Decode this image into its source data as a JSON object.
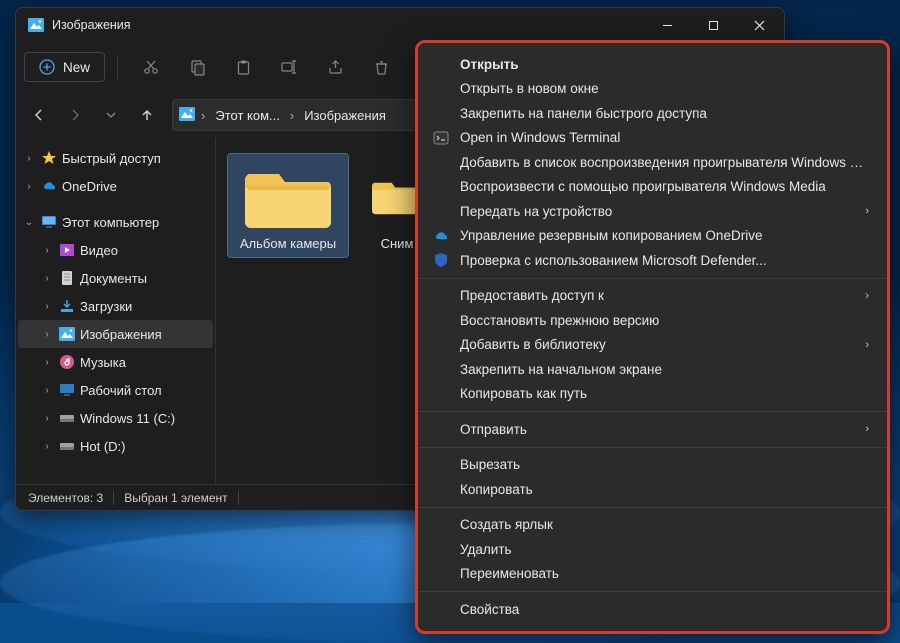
{
  "window": {
    "title": "Изображения"
  },
  "toolbar": {
    "new_label": "New"
  },
  "breadcrumb": {
    "seg1": "Этот ком...",
    "seg2": "Изображения"
  },
  "sidebar": {
    "quick_access": "Быстрый доступ",
    "onedrive": "OneDrive",
    "this_pc": "Этот компьютер",
    "videos": "Видео",
    "documents": "Документы",
    "downloads": "Загрузки",
    "pictures": "Изображения",
    "music": "Музыка",
    "desktop": "Рабочий стол",
    "cdrive": "Windows 11 (C:)",
    "ddrive": "Hot (D:)"
  },
  "content": {
    "folder1": "Альбом камеры",
    "folder2": "Сним"
  },
  "statusbar": {
    "count": "Элементов: 3",
    "selection": "Выбран 1 элемент"
  },
  "contextmenu": {
    "g1": {
      "open": "Открыть",
      "open_new_window": "Открыть в новом окне",
      "pin_quick_access": "Закрепить на панели быстрого доступа",
      "open_terminal": "Open in Windows Terminal",
      "add_wmp_playlist": "Добавить в список воспроизведения проигрывателя Windows Media",
      "play_wmp": "Воспроизвести с помощью проигрывателя Windows Media",
      "cast": "Передать на устройство",
      "onedrive_backup": "Управление резервным копированием OneDrive",
      "defender": "Проверка с использованием Microsoft Defender..."
    },
    "g2": {
      "give_access": "Предоставить доступ к",
      "restore_version": "Восстановить прежнюю версию",
      "add_library": "Добавить в библиотеку",
      "pin_start": "Закрепить на начальном экране",
      "copy_as_path": "Копировать как путь"
    },
    "g3": {
      "send_to": "Отправить"
    },
    "g4": {
      "cut": "Вырезать",
      "copy": "Копировать"
    },
    "g5": {
      "create_shortcut": "Создать ярлык",
      "delete": "Удалить",
      "rename": "Переименовать"
    },
    "g6": {
      "properties": "Свойства"
    }
  }
}
